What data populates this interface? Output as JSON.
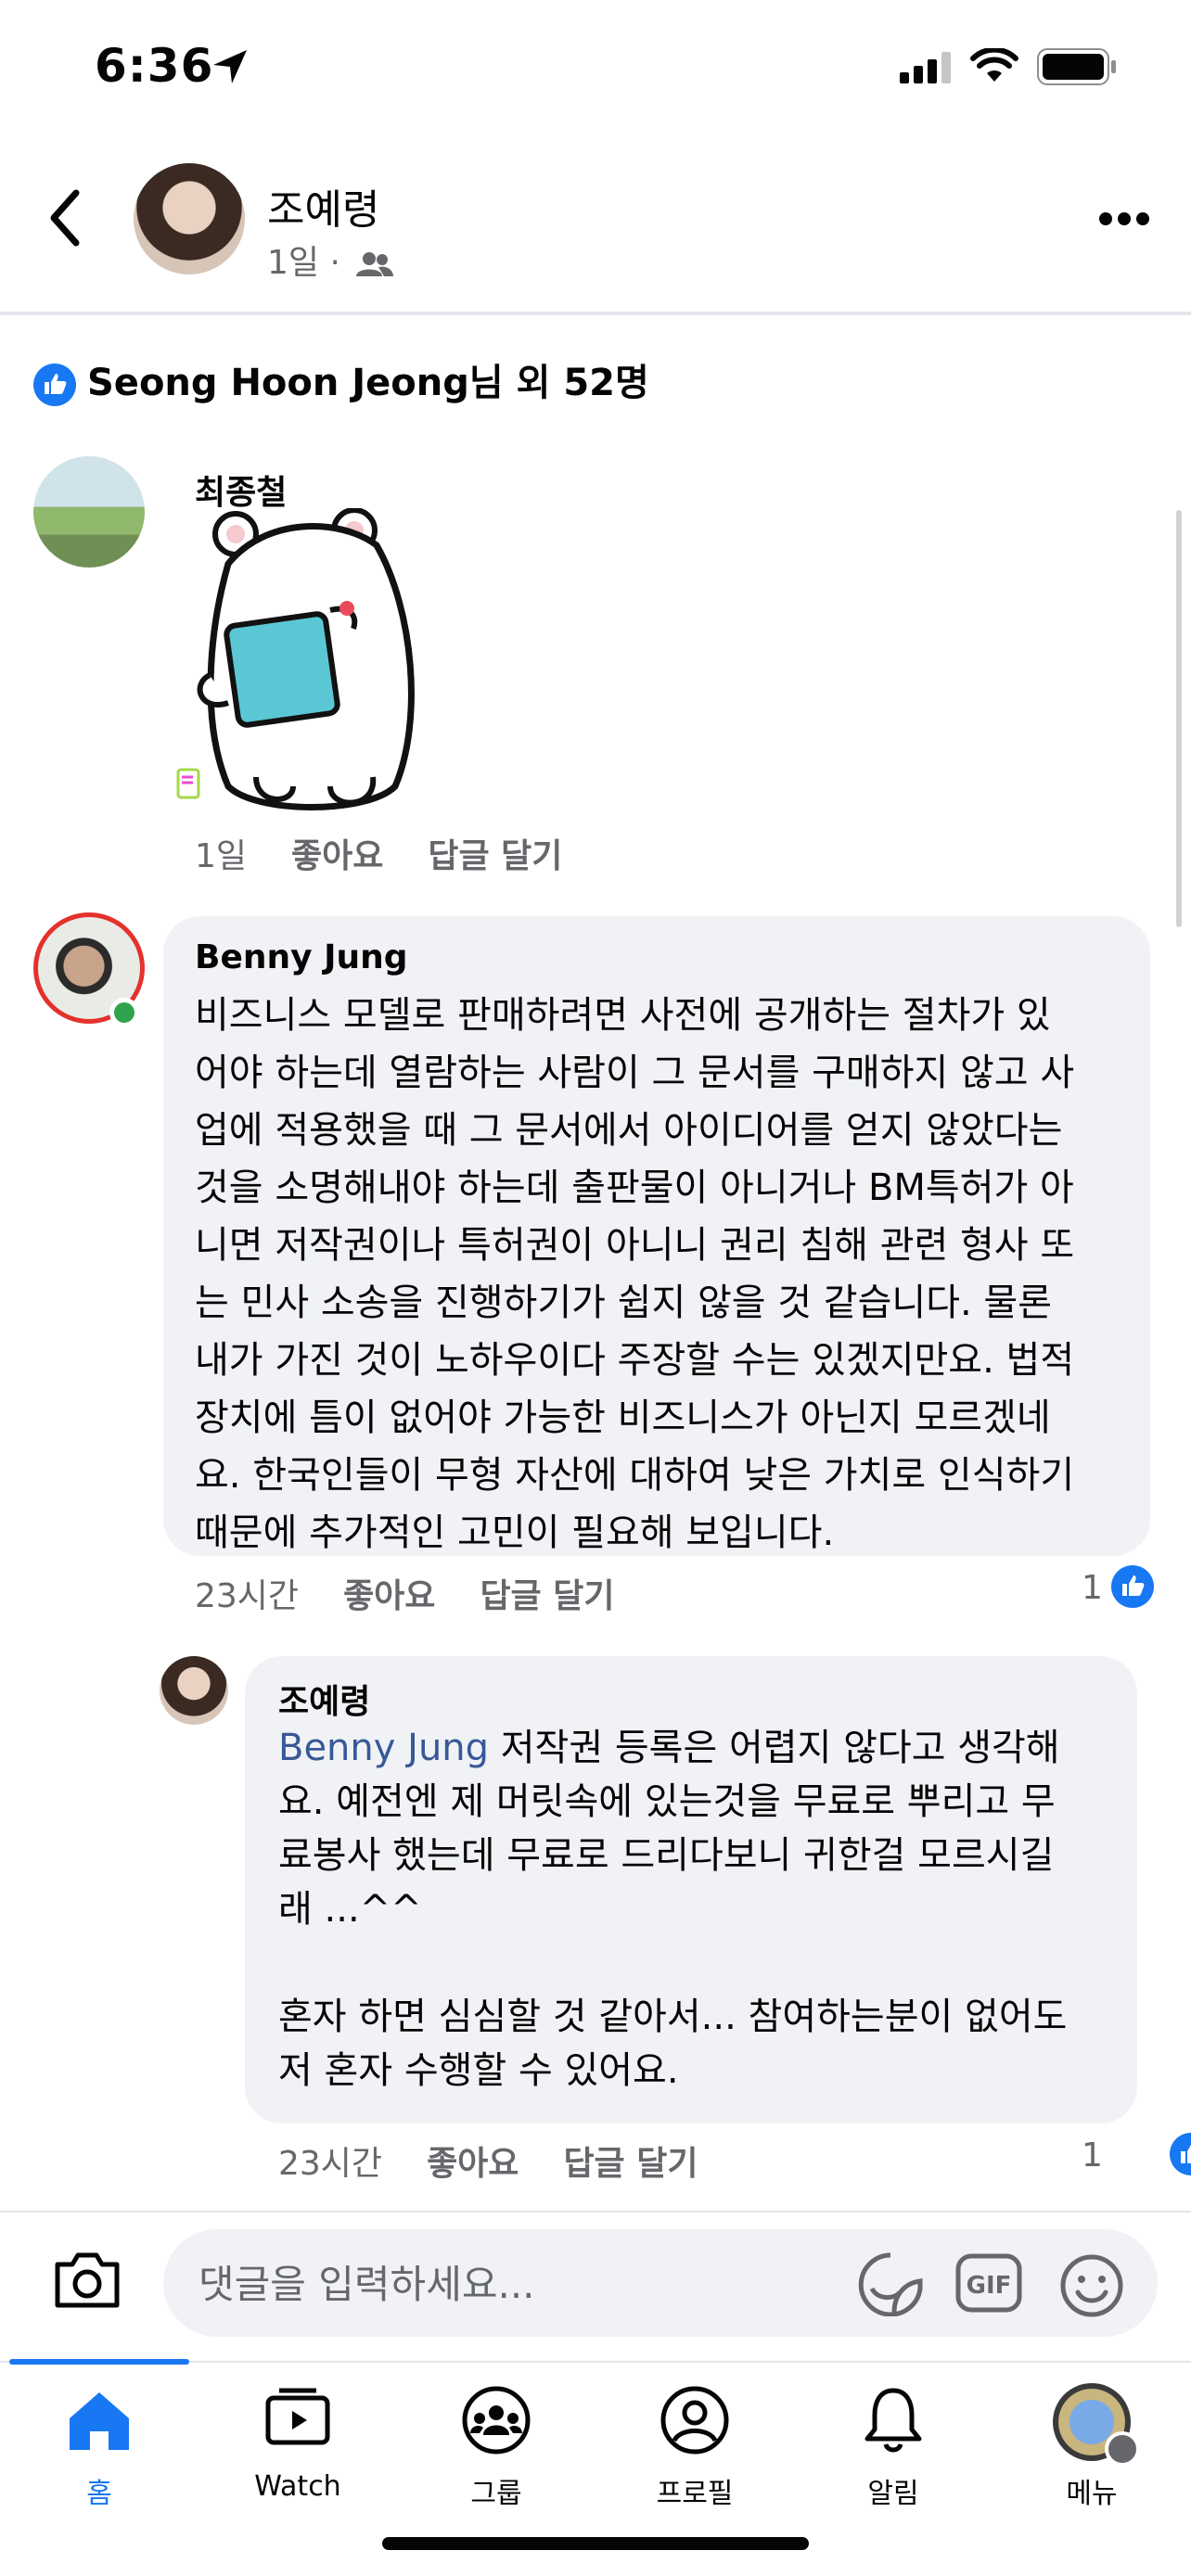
{
  "status_bar": {
    "time": "6:36"
  },
  "header": {
    "name": "조예령",
    "meta": "1일 ·"
  },
  "reactions": {
    "text": "Seong Hoon Jeong님 외 52명"
  },
  "comments": [
    {
      "author": "최종철",
      "time": "1일",
      "like_label": "좋아요",
      "reply_label": "답글 달기"
    },
    {
      "author": "Benny Jung",
      "lines": [
        "비즈니스 모델로 판매하려면 사전에 공개하는 절차가 있",
        "어야 하는데 열람하는 사람이 그 문서를 구매하지 않고 사",
        "업에 적용했을 때 그 문서에서 아이디어를 얻지 않았다는",
        "것을 소명해내야 하는데 출판물이 아니거나 BM특허가 아",
        "니면 저작권이나 특허권이 아니니 권리 침해 관련 형사 또",
        "는 민사 소송을 진행하기가 쉽지 않을 것 같습니다. 물론",
        "내가 가진 것이 노하우이다 주장할 수는 있겠지만요. 법적",
        "장치에 틈이 없어야 가능한 비즈니스가 아닌지 모르겠네",
        "요. 한국인들이 무형 자산에 대하여 낮은 가치로 인식하기",
        "때문에 추가적인 고민이 필요해 보입니다."
      ],
      "time": "23시간",
      "like_label": "좋아요",
      "reply_label": "답글 달기",
      "like_count": "1"
    },
    {
      "author": "조예령",
      "mention": "Benny Jung",
      "line1_rest": " 저작권 등록은 어렵지 않다고 생각해",
      "lines": [
        "요. 예전엔 제 머릿속에 있는것을 무료로 뿌리고 무",
        "료봉사 했는데 무료로 드리다보니 귀한걸 모르시길",
        "래 ...^^",
        "",
        "혼자 하면 심심할 것 같아서... 참여하는분이 없어도",
        "저 혼자 수행할 수 있어요."
      ],
      "time": "23시간",
      "like_label": "좋아요",
      "reply_label": "답글 달기",
      "like_count": "1"
    }
  ],
  "composer": {
    "placeholder": "댓글을 입력하세요..."
  },
  "nav": [
    {
      "label": "홈",
      "icon": "home-icon"
    },
    {
      "label": "Watch",
      "icon": "watch-icon"
    },
    {
      "label": "그룹",
      "icon": "groups-icon"
    },
    {
      "label": "프로필",
      "icon": "profile-icon"
    },
    {
      "label": "알림",
      "icon": "bell-icon"
    },
    {
      "label": "메뉴",
      "icon": "menu-avatar"
    }
  ],
  "colors": {
    "accent": "#1877f2",
    "bubble": "#f0f2f5",
    "muted": "#65676b"
  }
}
